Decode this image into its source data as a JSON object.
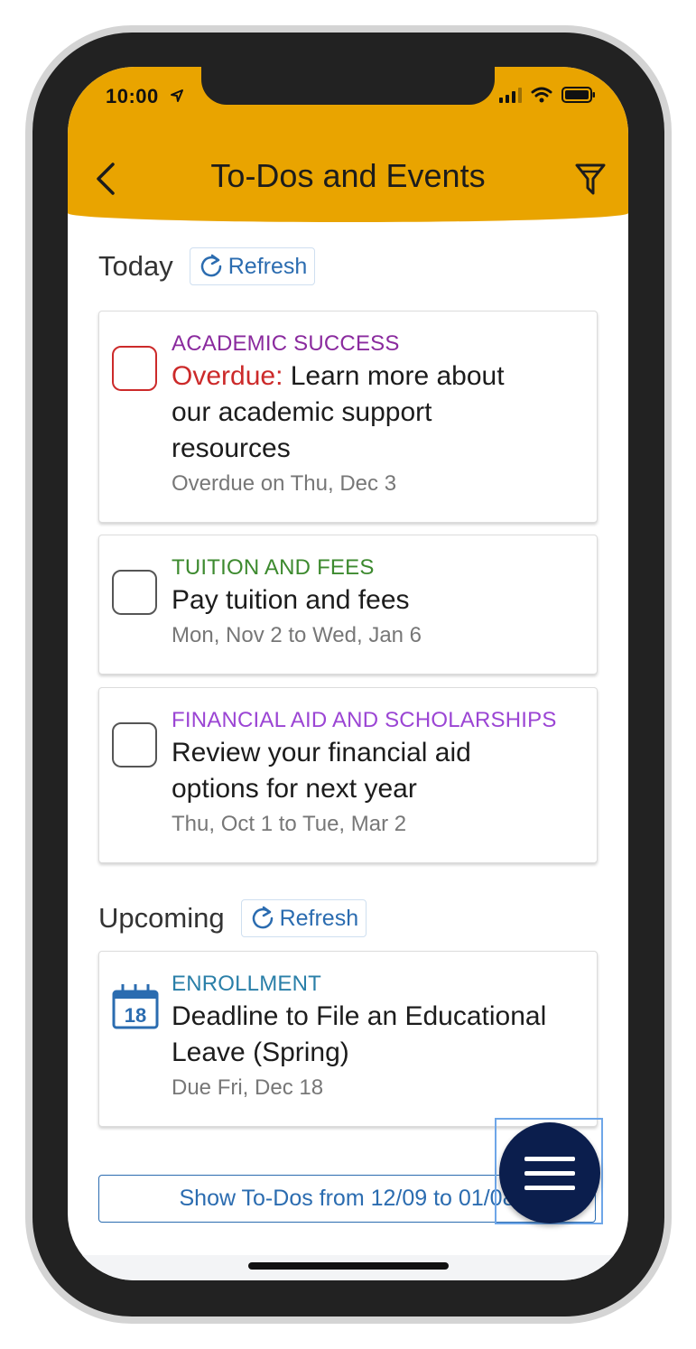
{
  "status_bar": {
    "time": "10:00"
  },
  "header": {
    "title": "To-Dos and Events"
  },
  "today": {
    "label": "Today",
    "refresh_label": "Refresh",
    "items": [
      {
        "category": "ACADEMIC SUCCESS",
        "category_color": "#8a2a9e",
        "overdue_prefix": "Overdue:",
        "title_lines": [
          "Learn more about",
          "our academic support",
          "resources"
        ],
        "date": "Overdue on Thu, Dec 3",
        "checked": false
      },
      {
        "category": "TUITION AND FEES",
        "category_color": "#3d8a2f",
        "title_lines": [
          "Pay tuition and fees"
        ],
        "date": "Mon, Nov 2 to Wed, Jan 6",
        "checked": false
      },
      {
        "category": "FINANCIAL AID AND SCHOLARSHIPS",
        "category_color": "#9b45d4",
        "title_lines": [
          "Review your financial aid",
          "options for next year"
        ],
        "date": "Thu, Oct 1 to Tue, Mar 2",
        "checked": false
      }
    ]
  },
  "upcoming": {
    "label": "Upcoming",
    "refresh_label": "Refresh",
    "items": [
      {
        "category": "ENROLLMENT",
        "category_color": "#2a7fa8",
        "calendar_day": "18",
        "title_lines": [
          "Deadline to File an Educational",
          "Leave (Spring)"
        ],
        "date": "Due Fri, Dec 18"
      }
    ]
  },
  "show_more_button": {
    "label": "Show To-Dos from 12/09 to 01/08"
  },
  "colors": {
    "header": "#e9a400",
    "accent": "#2b6cb0",
    "fab": "#0b1e4d",
    "overdue": "#cc2a2a"
  }
}
